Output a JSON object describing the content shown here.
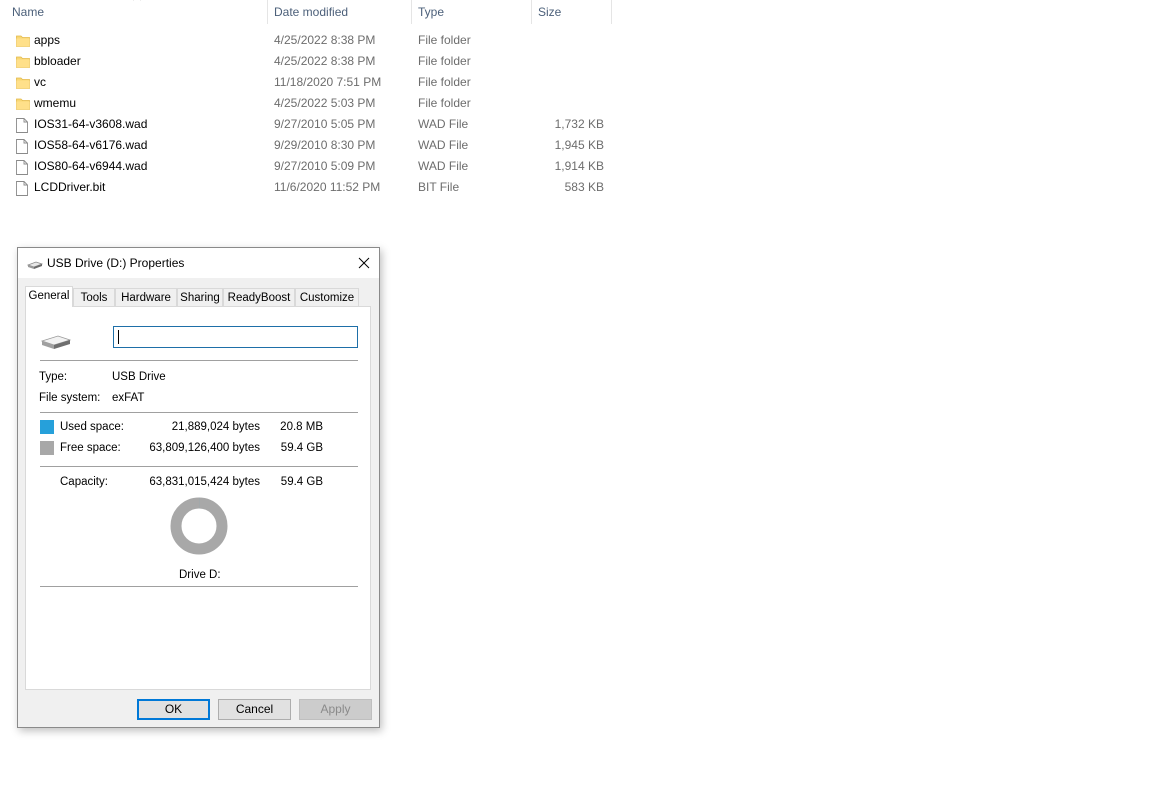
{
  "explorer": {
    "columns": {
      "name": "Name",
      "date_modified": "Date modified",
      "type": "Type",
      "size": "Size"
    },
    "files": [
      {
        "name": "apps",
        "date": "4/25/2022 8:38 PM",
        "type": "File folder",
        "size": "",
        "icon": "folder-icon"
      },
      {
        "name": "bbloader",
        "date": "4/25/2022 8:38 PM",
        "type": "File folder",
        "size": "",
        "icon": "folder-icon"
      },
      {
        "name": "vc",
        "date": "11/18/2020 7:51 PM",
        "type": "File folder",
        "size": "",
        "icon": "folder-icon"
      },
      {
        "name": "wmemu",
        "date": "4/25/2022 5:03 PM",
        "type": "File folder",
        "size": "",
        "icon": "folder-icon"
      },
      {
        "name": "IOS31-64-v3608.wad",
        "date": "9/27/2010 5:05 PM",
        "type": "WAD File",
        "size": "1,732 KB",
        "icon": "file-icon"
      },
      {
        "name": "IOS58-64-v6176.wad",
        "date": "9/29/2010 8:30 PM",
        "type": "WAD File",
        "size": "1,945 KB",
        "icon": "file-icon"
      },
      {
        "name": "IOS80-64-v6944.wad",
        "date": "9/27/2010 5:09 PM",
        "type": "WAD File",
        "size": "1,914 KB",
        "icon": "file-icon"
      },
      {
        "name": "LCDDriver.bit",
        "date": "11/6/2020 11:52 PM",
        "type": "BIT File",
        "size": "583 KB",
        "icon": "file-icon"
      }
    ]
  },
  "dialog": {
    "title": "USB Drive (D:) Properties",
    "tabs": [
      "General",
      "Tools",
      "Hardware",
      "Sharing",
      "ReadyBoost",
      "Customize"
    ],
    "active_tab": "General",
    "volume_label_value": "",
    "type_label": "Type:",
    "type_value": "USB Drive",
    "fs_label": "File system:",
    "fs_value": "exFAT",
    "used_label": "Used space:",
    "used_bytes": "21,889,024 bytes",
    "used_size": "20.8 MB",
    "free_label": "Free space:",
    "free_bytes": "63,809,126,400 bytes",
    "free_size": "59.4 GB",
    "capacity_label": "Capacity:",
    "capacity_bytes": "63,831,015,424 bytes",
    "capacity_size": "59.4 GB",
    "drive_label": "Drive D:",
    "used_fraction": 0.000343,
    "used_color": "#26a0da",
    "free_color": "#a8a8a8",
    "buttons": {
      "ok": "OK",
      "cancel": "Cancel",
      "apply": "Apply"
    }
  }
}
